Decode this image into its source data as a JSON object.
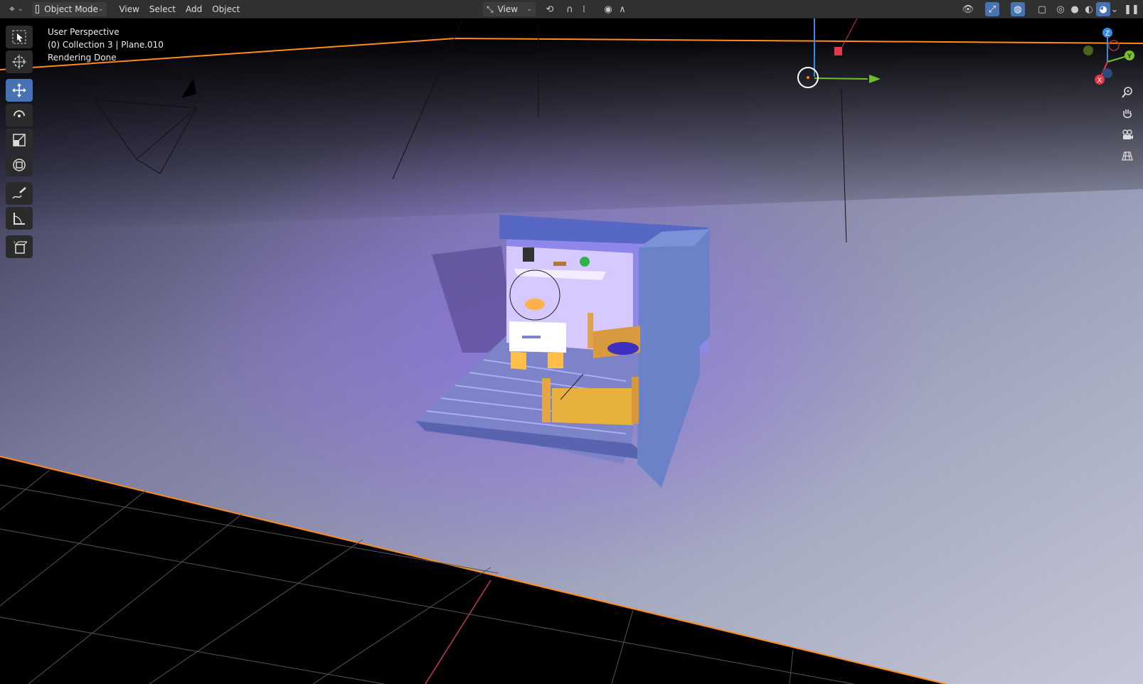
{
  "header": {
    "editor_type_icon": "editor-type-icon",
    "mode_label": "Object Mode",
    "menus": [
      "View",
      "Select",
      "Add",
      "Object"
    ],
    "orientation_label": "View",
    "colors": {
      "accent": "#4772b3",
      "selection_outline": "#ff8c1a"
    }
  },
  "viewport": {
    "info_lines": [
      "User Perspective",
      "(0) Collection 3 | Plane.010",
      "Rendering Done"
    ],
    "gizmo_axes": [
      "Z",
      "Y",
      "X"
    ],
    "tools": [
      "select-box-tool",
      "cursor-tool",
      "move-tool",
      "rotate-tool",
      "scale-tool",
      "transform-tool",
      "annotate-tool",
      "measure-tool",
      "add-cube-tool"
    ],
    "nav": [
      "zoom-icon",
      "hand-pan-icon",
      "camera-view-icon",
      "ortho-grid-icon"
    ]
  }
}
